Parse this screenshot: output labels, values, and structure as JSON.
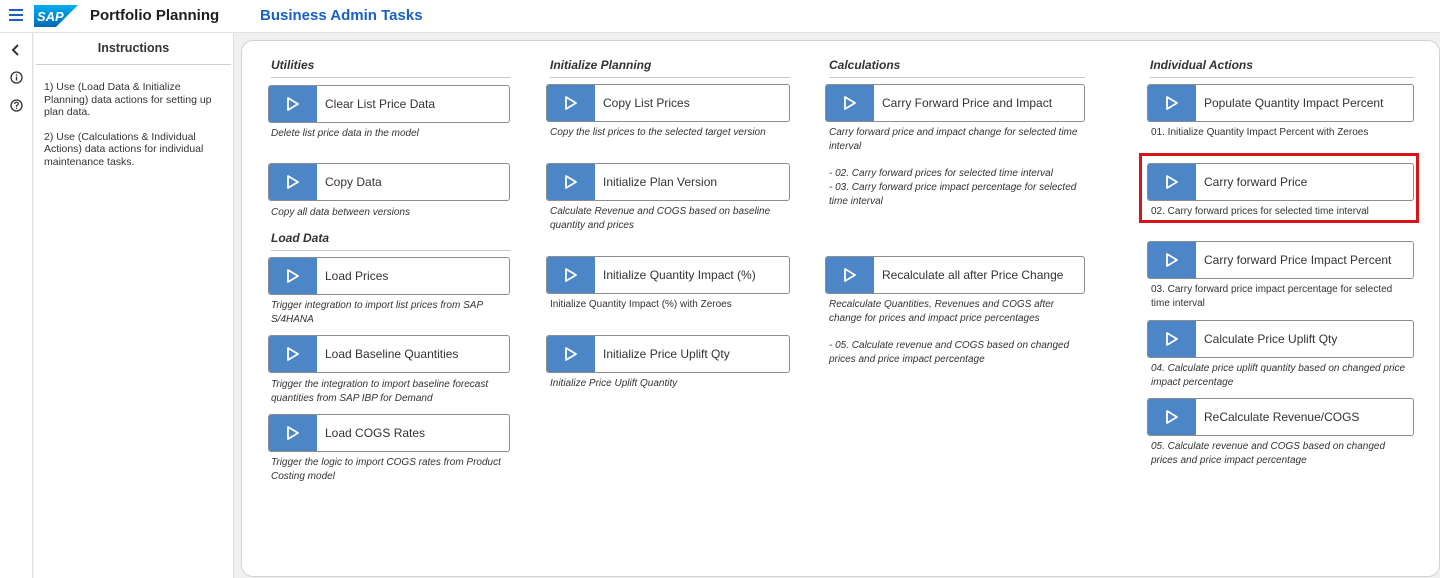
{
  "shell": {
    "logo_text": "SAP",
    "app_title": "Portfolio Planning",
    "story_title": "Business Admin Tasks"
  },
  "rail": {
    "items": [
      {
        "icon": "chevron-left-icon"
      },
      {
        "icon": "info-icon"
      },
      {
        "icon": "help-icon"
      }
    ]
  },
  "instructions": {
    "title": "Instructions",
    "lines": [
      "1) Use (Load Data & Initialize Planning) data actions for setting up plan data.",
      "2) Use (Calculations & Individual Actions) data actions for individual maintenance tasks."
    ]
  },
  "sections": {
    "utilities": "Utilities",
    "load_data": "Load Data",
    "initialize_planning": "Initialize Planning",
    "calculations": "Calculations",
    "individual_actions": "Individual Actions"
  },
  "actions": {
    "clear_list_price": {
      "label": "Clear List Price Data",
      "desc": "Delete list price data in the model"
    },
    "copy_data": {
      "label": "Copy Data",
      "desc": "Copy all data between versions"
    },
    "load_prices": {
      "label": "Load Prices",
      "desc": "Trigger integration to import list prices from SAP S/4HANA"
    },
    "load_baseline": {
      "label": "Load Baseline Quantities",
      "desc": "Trigger the integration to import baseline forecast quantities from SAP IBP for Demand"
    },
    "load_cogs": {
      "label": "Load COGS Rates",
      "desc": "Trigger the logic to import COGS rates from Product Costing model"
    },
    "copy_list_prices": {
      "label": "Copy List Prices",
      "desc": "Copy the list prices to the selected target version"
    },
    "init_plan_version": {
      "label": "Initialize Plan Version",
      "desc": "Calculate Revenue and COGS based on baseline quantity and prices"
    },
    "init_qty_impact": {
      "label": "Initialize Quantity Impact (%)",
      "desc": "Initialize Quantity Impact (%) with Zeroes"
    },
    "init_price_uplift": {
      "label": "Initialize Price Uplift Qty",
      "desc": "Initialize Price Uplift Quantity"
    },
    "carry_fwd_price_impact": {
      "label": "Carry Forward Price and Impact",
      "desc": "Carry forward price and impact change for selected time interval",
      "desc2": "- 02. Carry forward prices for selected time interval",
      "desc3": "- 03. Carry forward price impact percentage for selected time interval"
    },
    "recalc_all": {
      "label": "Recalculate all after Price Change",
      "desc": "Recalculate Quantities, Revenues and COGS after change for prices and impact price percentages",
      "desc2": "- 05. Calculate revenue and COGS based on changed prices and price impact percentage"
    },
    "populate_qty_impact": {
      "label": "Populate Quantity Impact Percent",
      "desc": "01. Initialize Quantity Impact Percent with Zeroes"
    },
    "carry_fwd_price": {
      "label": "Carry forward Price",
      "desc": "02. Carry forward prices for selected time interval"
    },
    "carry_fwd_price_impact_pct": {
      "label": "Carry forward Price Impact Percent",
      "desc": "03. Carry forward price impact percentage for selected time interval"
    },
    "calc_price_uplift": {
      "label": "Calculate Price Uplift Qty",
      "desc": "04. Calculate price uplift quantity based on changed price impact percentage"
    },
    "recalc_revenue_cogs": {
      "label": "ReCalculate Revenue/COGS",
      "desc": "05. Calculate revenue and COGS based on changed prices and price impact percentage"
    }
  },
  "colors": {
    "accent": "#1a60c4",
    "play_button": "#4c86c6",
    "highlight": "#d8141b"
  }
}
